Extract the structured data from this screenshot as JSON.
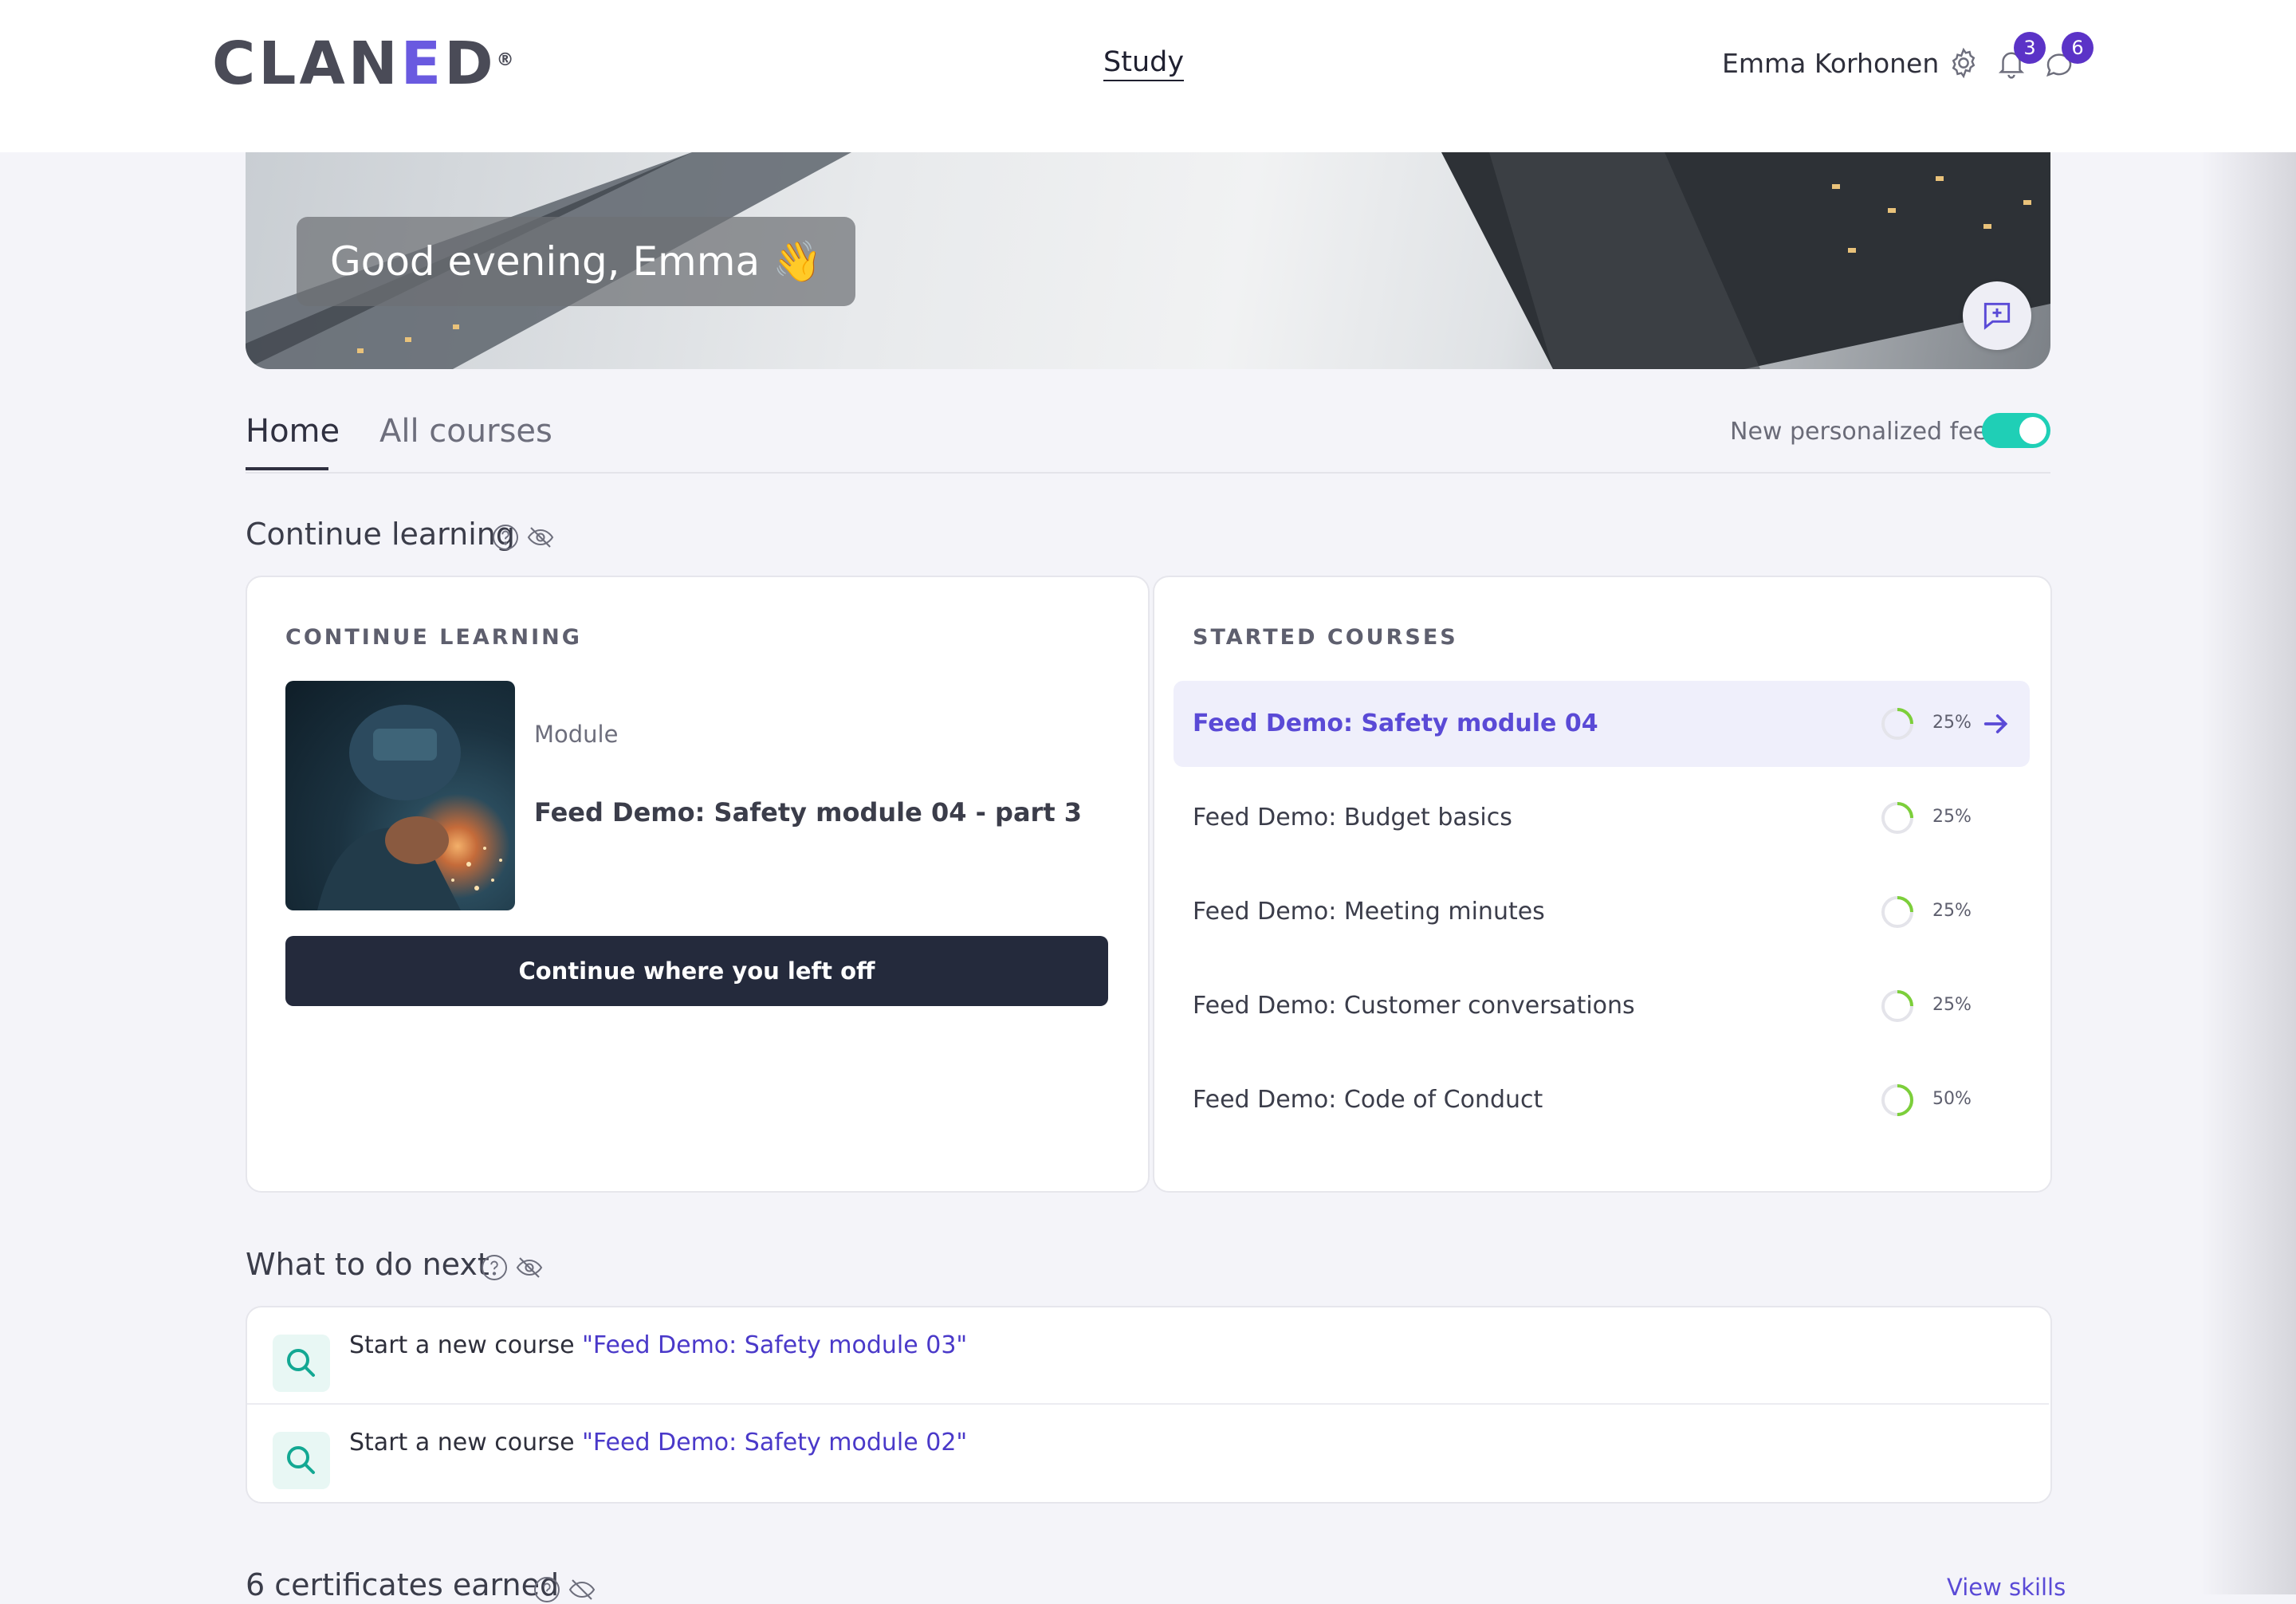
{
  "header": {
    "logo_text": "CLANED",
    "nav": {
      "study": "Study"
    },
    "user_name": "Emma Korhonen",
    "notifications_count": "3",
    "messages_count": "6"
  },
  "banner": {
    "greeting": "Good evening, Emma 👋"
  },
  "tabs": {
    "home": "Home",
    "all_courses": "All courses",
    "feed_toggle_label": "New personalized feed",
    "feed_toggle_on": true
  },
  "continue_learning": {
    "title": "Continue learning",
    "card_caption": "CONTINUE LEARNING",
    "module_label": "Module",
    "module_title": "Feed Demo: Safety module 04 - part 3",
    "cta": "Continue where you left off"
  },
  "started_courses": {
    "caption": "STARTED COURSES",
    "items": [
      {
        "name": "Feed Demo: Safety module 04",
        "progress": "25%",
        "value": 0.25
      },
      {
        "name": "Feed Demo: Budget basics",
        "progress": "25%",
        "value": 0.25
      },
      {
        "name": "Feed Demo: Meeting minutes",
        "progress": "25%",
        "value": 0.25
      },
      {
        "name": "Feed Demo: Customer conversations",
        "progress": "25%",
        "value": 0.25
      },
      {
        "name": "Feed Demo: Code of Conduct",
        "progress": "50%",
        "value": 0.5
      }
    ]
  },
  "what_next": {
    "title": "What to do next",
    "items": [
      {
        "prefix": "Start a new course ",
        "link": "\"Feed Demo: Safety module 03\""
      },
      {
        "prefix": "Start a new course ",
        "link": "\"Feed Demo: Safety module 02\""
      }
    ]
  },
  "certificates": {
    "title": "6 certificates earned",
    "view_skills": "View skills"
  },
  "colors": {
    "accent": "#5a4ad6",
    "toggle": "#1fcfb6",
    "progress": "#7ccf3a",
    "button_dark": "#242a3c"
  }
}
